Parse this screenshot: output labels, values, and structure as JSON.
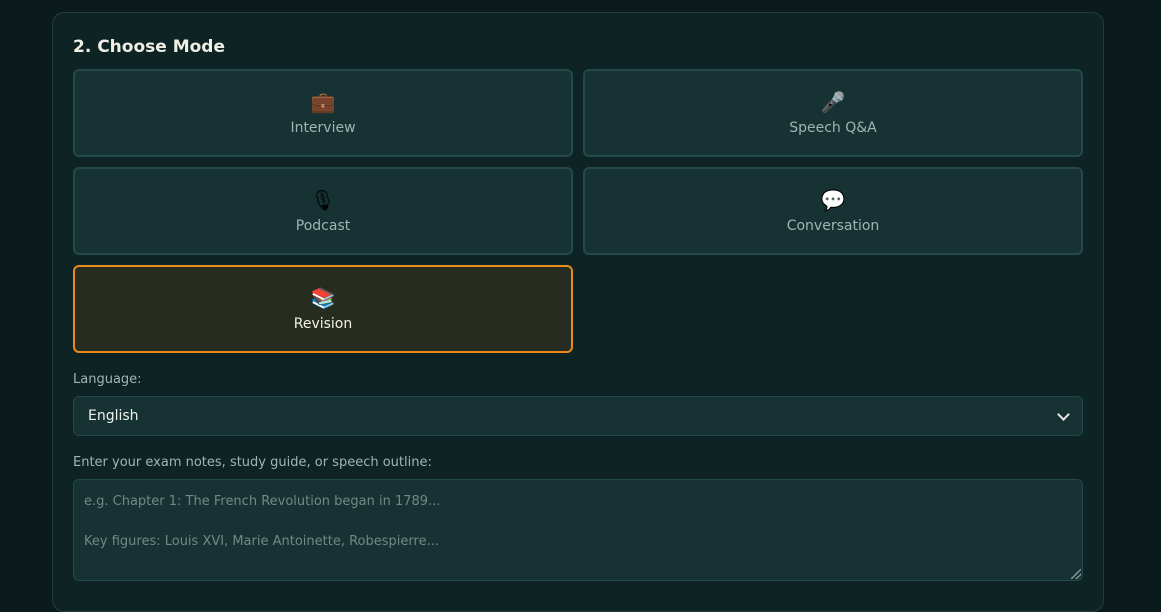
{
  "section": {
    "title": "2. Choose Mode"
  },
  "modes": [
    {
      "label": "Interview",
      "icon": "💼",
      "icon_name": "briefcase-icon",
      "selected": false
    },
    {
      "label": "Speech Q&A",
      "icon": "🎤",
      "icon_name": "microphone-icon",
      "selected": false
    },
    {
      "label": "Podcast",
      "icon": "🎙",
      "icon_name": "studio-microphone-icon",
      "selected": false
    },
    {
      "label": "Conversation",
      "icon": "💬",
      "icon_name": "speech-bubble-icon",
      "selected": false
    },
    {
      "label": "Revision",
      "icon": "📚",
      "icon_name": "books-icon",
      "selected": true
    }
  ],
  "language": {
    "label": "Language:",
    "selected": "English"
  },
  "notes": {
    "label": "Enter your exam notes, study guide, or speech outline:",
    "placeholder": "e.g. Chapter 1: The French Revolution began in 1789...\n\nKey figures: Louis XVI, Marie Antoinette, Robespierre...",
    "value": ""
  },
  "colors": {
    "background": "#0b1b1b",
    "panel": "#0e2323",
    "card": "#173232",
    "card_border": "#24494a",
    "accent_selected": "#e98a1d",
    "text_primary": "#f0efe6",
    "text_muted": "#9bb7b3"
  }
}
